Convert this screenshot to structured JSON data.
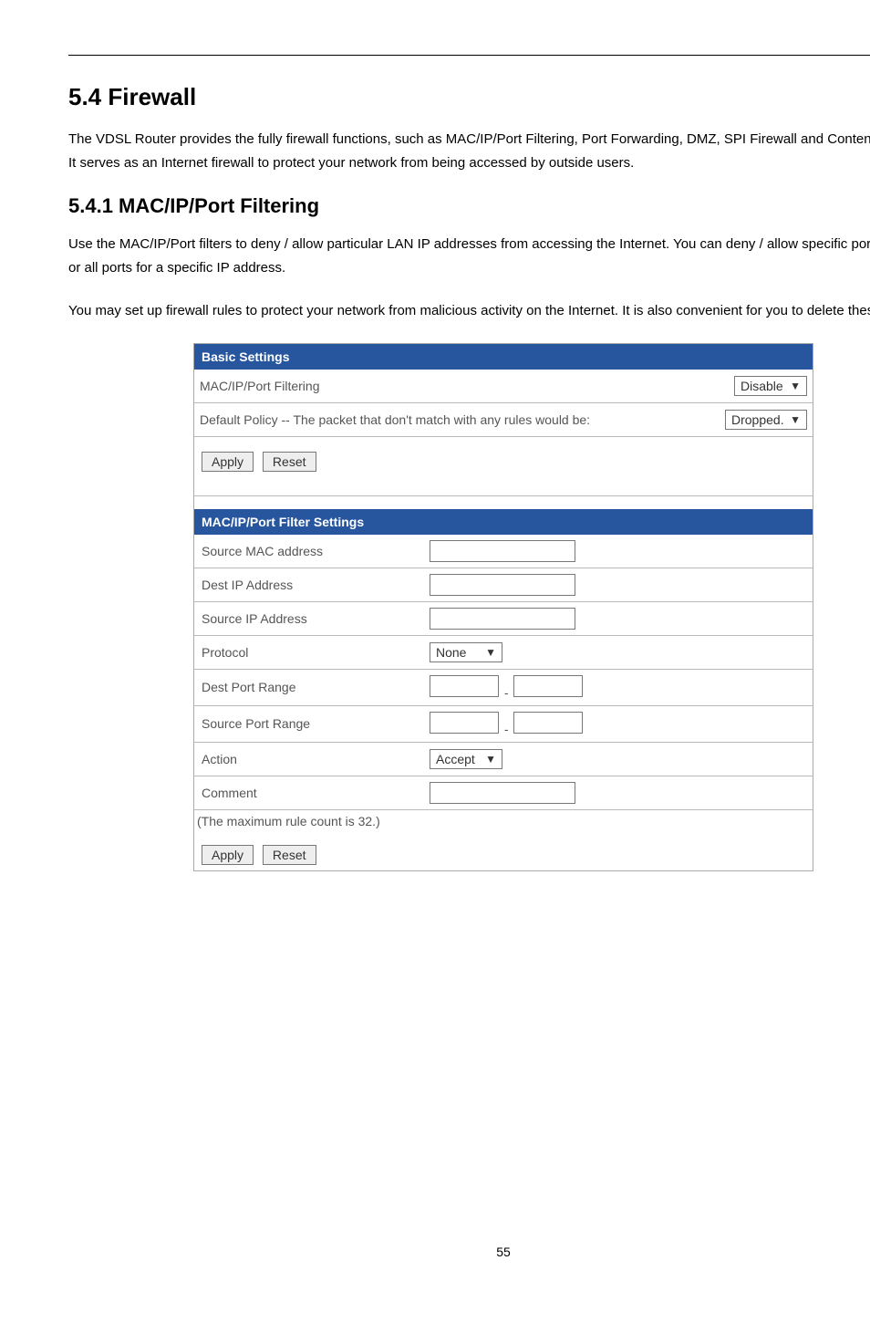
{
  "heading": "5.4 Firewall",
  "intro": "The VDSL Router provides the fully firewall functions, such as MAC/IP/Port Filtering, Port Forwarding, DMZ, SPI Firewall and Content Filtering. It serves as an Internet firewall to protect your network from being accessed by outside users.",
  "sub_heading": "5.4.1 MAC/IP/Port Filtering",
  "sub_para1": "Use the MAC/IP/Port filters to deny / allow particular LAN IP addresses from accessing the Internet. You can deny / allow specific port numbers or all ports for a specific IP address.",
  "sub_para2": "You may set up firewall rules to protect your network from malicious activity on the Internet. It is also convenient for you to delete these settings.",
  "basic": {
    "title": "Basic Settings",
    "filtering_label": "MAC/IP/Port Filtering",
    "filtering_value": "Disable",
    "policy_label": "Default Policy -- The packet that don't match with any rules would be:",
    "policy_value": "Dropped.",
    "apply": "Apply",
    "reset": "Reset"
  },
  "filter": {
    "title": "MAC/IP/Port Filter Settings",
    "rows": {
      "src_mac": "Source MAC address",
      "dest_ip": "Dest IP Address",
      "src_ip": "Source IP Address",
      "protocol": "Protocol",
      "protocol_value": "None",
      "dest_port": "Dest Port Range",
      "src_port": "Source Port Range",
      "action": "Action",
      "action_value": "Accept",
      "comment": "Comment"
    },
    "footnote": "(The maximum rule count is 32.)",
    "apply": "Apply",
    "reset": "Reset"
  },
  "range_sep": "-",
  "page_number": "55"
}
